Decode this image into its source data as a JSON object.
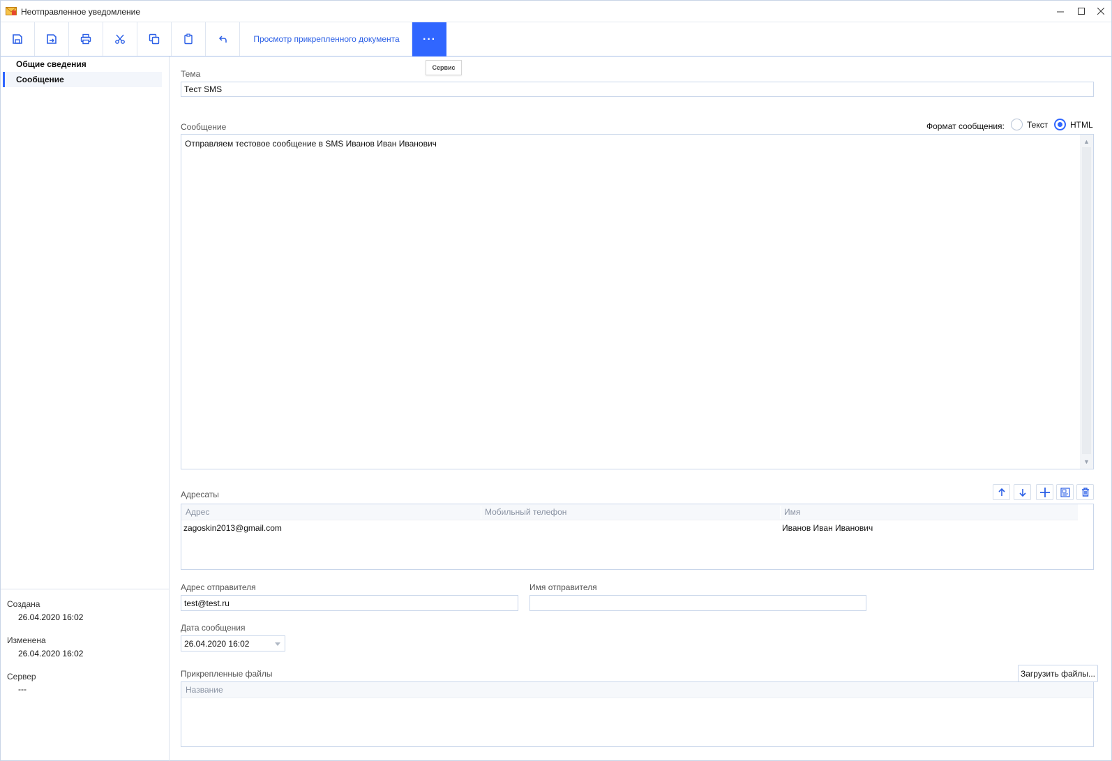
{
  "window": {
    "title": "Неотправленное уведомление"
  },
  "toolbar": {
    "attachment_link": "Просмотр прикрепленного документа",
    "more_label": "···",
    "tooltip": "Сервис"
  },
  "sidebar": {
    "items": [
      {
        "label": "Общие сведения",
        "active": false
      },
      {
        "label": "Сообщение",
        "active": true
      }
    ],
    "meta": {
      "created_label": "Создана",
      "created_value": "26.04.2020 16:02",
      "modified_label": "Изменена",
      "modified_value": "26.04.2020 16:02",
      "server_label": "Сервер",
      "server_value": "---"
    }
  },
  "form": {
    "subject_label": "Тема",
    "subject_value": "Тест SMS",
    "message_label": "Сообщение",
    "format_label": "Формат сообщения:",
    "format_options": [
      "Текст",
      "HTML"
    ],
    "format_selected": "HTML",
    "message_body": "Отправляем тестовое сообщение в SMS Иванов Иван Иванович",
    "recipients_label": "Адресаты",
    "recipients_columns": [
      "Адрес",
      "Мобильный телефон",
      "Имя"
    ],
    "recipients_rows": [
      {
        "address": "zagoskin2013@gmail.com",
        "phone": "",
        "name": "Иванов Иван Иванович"
      }
    ],
    "sender_address_label": "Адрес отправителя",
    "sender_address_value": "test@test.ru",
    "sender_name_label": "Имя отправителя",
    "sender_name_value": "",
    "message_date_label": "Дата сообщения",
    "message_date_value": "26.04.2020 16:02",
    "attachments_label": "Прикрепленные файлы",
    "attachments_columns": [
      "Название"
    ],
    "upload_button": "Загрузить файлы..."
  },
  "colors": {
    "accent": "#3066ff",
    "link": "#2b5fe6",
    "border": "#c9d6ea"
  }
}
